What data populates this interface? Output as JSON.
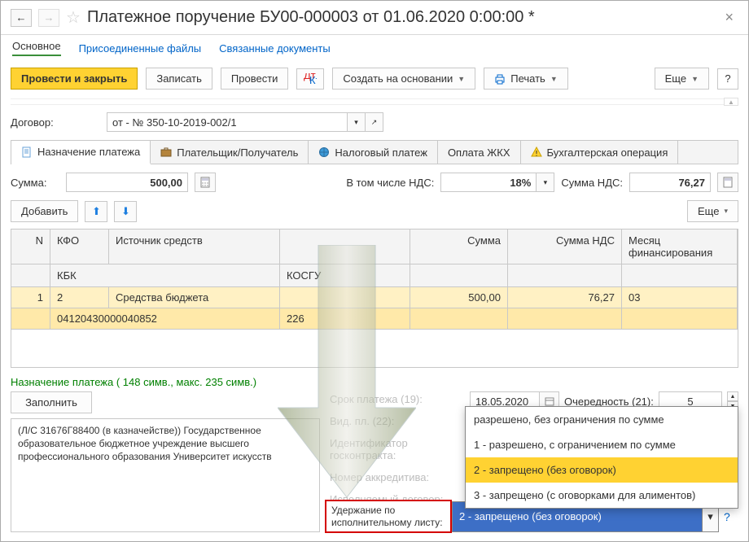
{
  "title": "Платежное поручение БУ00-000003 от 01.06.2020 0:00:00 *",
  "links": {
    "main": "Основное",
    "files": "Присоединенные файлы",
    "related": "Связанные документы"
  },
  "toolbar": {
    "post_close": "Провести и закрыть",
    "save": "Записать",
    "post": "Провести",
    "create_on": "Создать на основании",
    "print": "Печать",
    "more": "Еще"
  },
  "contract": {
    "label": "Договор:",
    "value": "от - № 350-10-2019-002/1"
  },
  "tabs": {
    "purpose": "Назначение платежа",
    "payer": "Плательщик/Получатель",
    "tax": "Налоговый платеж",
    "zhkh": "Оплата ЖКХ",
    "accounting": "Бухгалтерская операция"
  },
  "sum": {
    "label": "Сумма:",
    "value": "500,00",
    "incl": "В том числе НДС:",
    "nds_rate": "18%",
    "nds_label": "Сумма НДС:",
    "nds_value": "76,27"
  },
  "tbltool": {
    "add": "Добавить",
    "more": "Еще"
  },
  "tbl": {
    "head": {
      "n": "N",
      "kfo": "КФО",
      "src": "Источник средств",
      "kbk": "КБК",
      "kosgu": "КОСГУ",
      "sum": "Сумма",
      "nds": "Сумма НДС",
      "month": "Месяц финансирования"
    },
    "row": {
      "n": "1",
      "kfo": "2",
      "src": "Средства бюджета",
      "kbk": "04120430000040852",
      "kosgu": "226",
      "sum": "500,00",
      "nds": "76,27",
      "month": "03"
    }
  },
  "purpose": {
    "head": "Назначение платежа ( 148 симв., макс. 235 симв.)",
    "fill": "Заполнить",
    "text": "(Л/С 31676Г88400 (в казначействе)) Государственное образовательное бюджетное учреждение  высшего профессионального образования Университет искусств",
    "mid": {
      "term": "Срок платежа (19):",
      "vid": "Вид. пл. (22):",
      "ident": "Идентификатор госконтракта:",
      "accr": "Номер аккредитива:",
      "isp": "Исполняемый договор:"
    },
    "right": {
      "date": "18.05.2020",
      "order_lbl": "Очередность (21):",
      "order_val": "5"
    },
    "withhold": {
      "label": "Удержание по исполнительному листу:",
      "value": "2 - запрещено (без оговорок)"
    }
  },
  "dropdown": {
    "opts": [
      "разрешено, без ограничения по сумме",
      "1 - разрешено, с ограничением по сумме",
      "2 - запрещено (без оговорок)",
      "3 - запрещено (с оговорками для алиментов)"
    ]
  }
}
